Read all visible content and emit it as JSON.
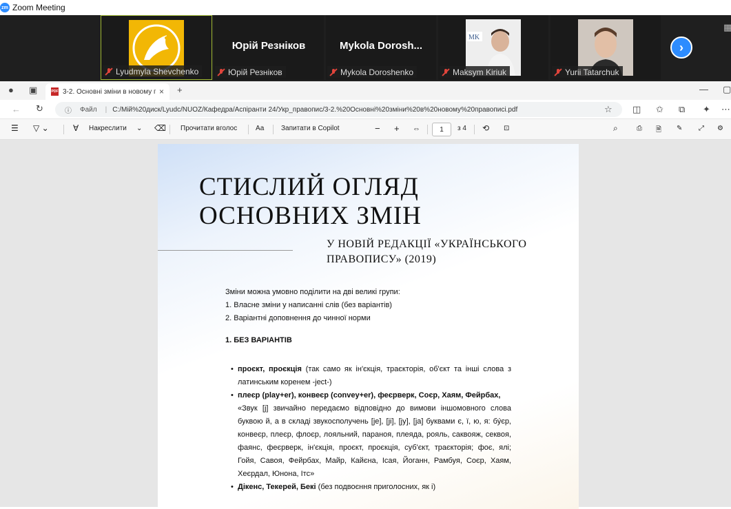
{
  "zoom": {
    "window_title": "Zoom Meeting",
    "logo_text": "zm",
    "participants": [
      {
        "name": "Lyudmyla Shevchenko",
        "big_name": "",
        "muted": true
      },
      {
        "name": "Юрій Резніков",
        "big_name": "Юрій Резніков",
        "muted": true
      },
      {
        "name": "Mykola Doroshenko",
        "big_name": "Mykola  Dorosh...",
        "muted": true
      },
      {
        "name": "Maksym Kiriuk",
        "big_name": "",
        "muted": true
      },
      {
        "name": "Yurii Tatarchuk",
        "big_name": "",
        "muted": true
      }
    ],
    "next_icon": "chevron-right-icon"
  },
  "browser": {
    "tab_title": "3-2. Основні зміни в новому пр",
    "tab_close": "×",
    "new_tab": "+",
    "url_label": "Файл",
    "url": "C:/Мій%20диск/Lyudc/NUOZ/Кафедра/Аспіранти 24/Укр_правопис/3-2.%20Основні%20зміни%20в%20новому%20правописі.pdf"
  },
  "pdf_toolbar": {
    "draw_label": "Накреслити",
    "read_aloud": "Прочитати вголос",
    "ask_copilot": "Запитати в Copilot",
    "zoom_out": "−",
    "zoom_in": "+",
    "page_number": "1",
    "page_total": "з 4",
    "text_size": "Аа"
  },
  "document": {
    "title_line1": "СТИСЛИЙ ОГЛЯД",
    "title_line2": "ОСНОВНИХ ЗМІН",
    "subtitle_line1": "У НОВІЙ РЕДАКЦІЇ «УКРАЇНСЬКОГО",
    "subtitle_line2": "ПРАВОПИСУ» (2019)",
    "intro": [
      "Зміни можна умовно поділити на дві великі групи:",
      "1. Власне зміни у написанні слів (без варіантів)",
      "2. Варіантні доповнення до чинної норми"
    ],
    "section1": "1. БЕЗ ВАРІАНТІВ",
    "bullet1_bold": "проєкт, проєкція",
    "bullet1_rest": " (так само як ін'єкція, траєкторія, об'єкт та інші слова з латинським коренем -ject-)",
    "bullet2_bold": "плеєр (play+er), конвеєр (convey+er), феєрверк, Соєр, Хаям, Фейрбах,",
    "bullet2_quote": "«Звук [j] звичайно передаємо відповідно до вимови іншомовного слова буквою й, а в складі звукосполучень [jе], [jі], [jу], [jа] буквами є, ї, ю, я: бу́єр, конвеєр, плеєр, флоєр, лояльний, параноя, плеяда, рояль, саквояж, секвоя, фаянс, феєрверк, ін'єкція, проєкт, проєкція, суб'єкт, траєкторія; фоє, ялі; Гойя, Савоя, Фейрбах, Майр, Кайєна, Ісая, Йоганн, Рамбуя, Соєр, Хаям, Хеєрдал, Юнона, Ітс»",
    "bullet3_bold": "Дікенс, Текерей, Бекі",
    "bullet3_rest": " (без подвоєння приголосних, як і)"
  }
}
